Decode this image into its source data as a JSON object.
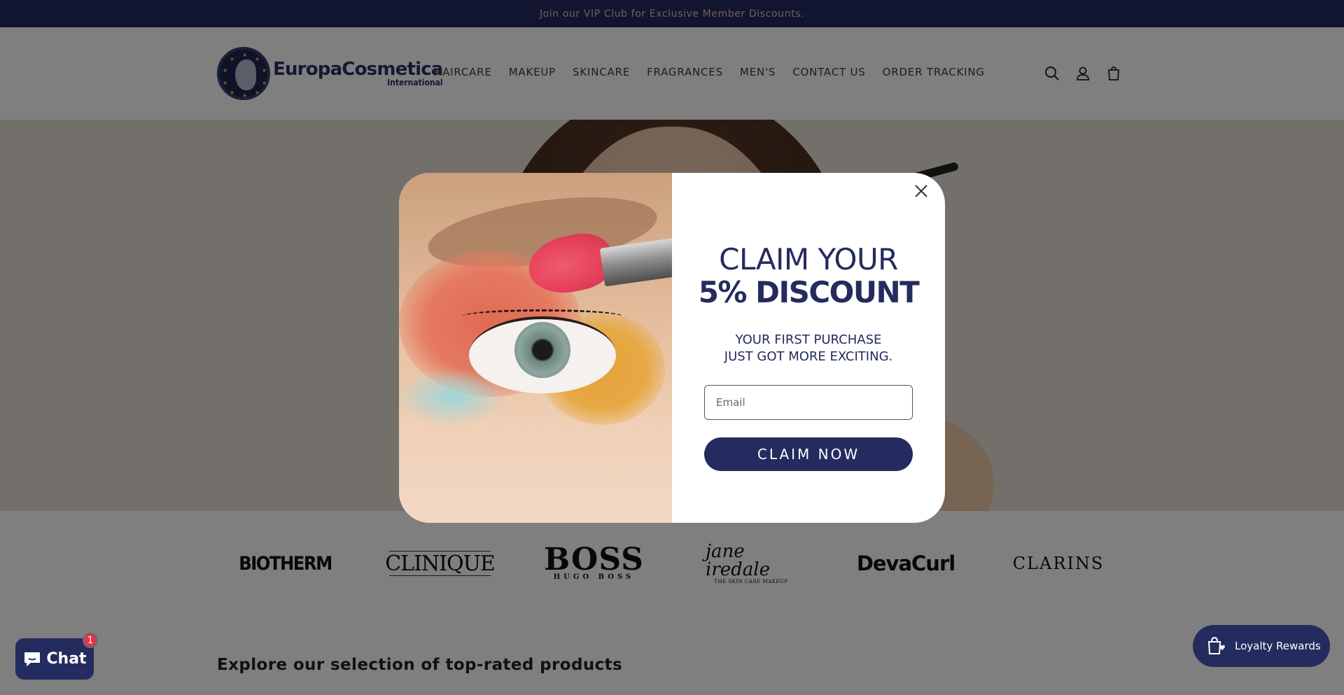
{
  "announcement": {
    "text": "Join our VIP Club for Exclusive Member Discounts."
  },
  "logo": {
    "main": "EuropaCosmetica",
    "sub": "International"
  },
  "nav": {
    "items": [
      {
        "label": "HAIRCARE"
      },
      {
        "label": "MAKEUP"
      },
      {
        "label": "SKINCARE"
      },
      {
        "label": "FRAGRANCES"
      },
      {
        "label": "MEN'S"
      },
      {
        "label": "CONTACT US"
      },
      {
        "label": "ORDER TRACKING"
      }
    ]
  },
  "header_icons": [
    "search-icon",
    "account-icon",
    "cart-icon"
  ],
  "brands": {
    "biotherm": "BIOTHERM",
    "clinique": "CLINIQUE",
    "boss": {
      "main": "BOSS",
      "sub": "HUGO BOSS"
    },
    "jane": {
      "main": "jane iredale",
      "sub": "THE SKIN CARE MAKEUP"
    },
    "devacurl": "DevaCurl",
    "clarins": "CLARINS"
  },
  "explore": {
    "heading": "Explore our selection of top-rated products"
  },
  "popup": {
    "heading_line1": "CLAIM YOUR",
    "heading_line2": "5% DISCOUNT",
    "sub_line1": "YOUR FIRST PURCHASE",
    "sub_line2": "JUST GOT MORE EXCITING.",
    "email_placeholder": "Email",
    "button_label": "CLAIM NOW"
  },
  "chat": {
    "label": "Chat",
    "badge_count": "1"
  },
  "loyalty": {
    "label": "Loyalty Rewards"
  },
  "colors": {
    "navy": "#242b5e",
    "announce_text": "#d8c6a6",
    "badge": "#e0364a"
  }
}
